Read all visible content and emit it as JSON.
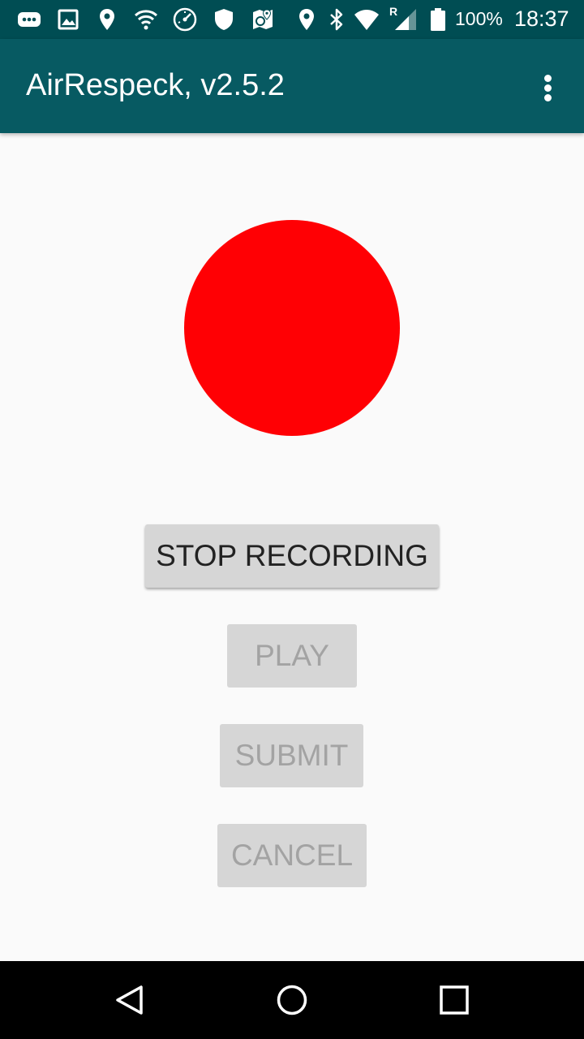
{
  "status_bar": {
    "background": "#004d53",
    "icons": [
      "more-notifications-icon",
      "image-icon",
      "location-icon",
      "wifi-icon",
      "speedometer-icon",
      "shield-icon",
      "maps-icon",
      "location-icon",
      "bluetooth-icon",
      "wifi-signal-icon",
      "cell-signal-icon",
      "battery-icon"
    ],
    "roaming_indicator": "R",
    "battery_percent": "100%",
    "time": "18:37"
  },
  "app_bar": {
    "title": "AirRespeck, v2.5.2",
    "background": "#075a62",
    "overflow_icon": "more-vert-icon"
  },
  "main": {
    "recording_indicator_color": "#ff0004",
    "buttons": {
      "stop_recording": "STOP RECORDING",
      "play": "PLAY",
      "submit": "SUBMIT",
      "cancel": "CANCEL"
    }
  },
  "nav_bar": {
    "icons": [
      "back-icon",
      "home-icon",
      "recents-icon"
    ]
  }
}
